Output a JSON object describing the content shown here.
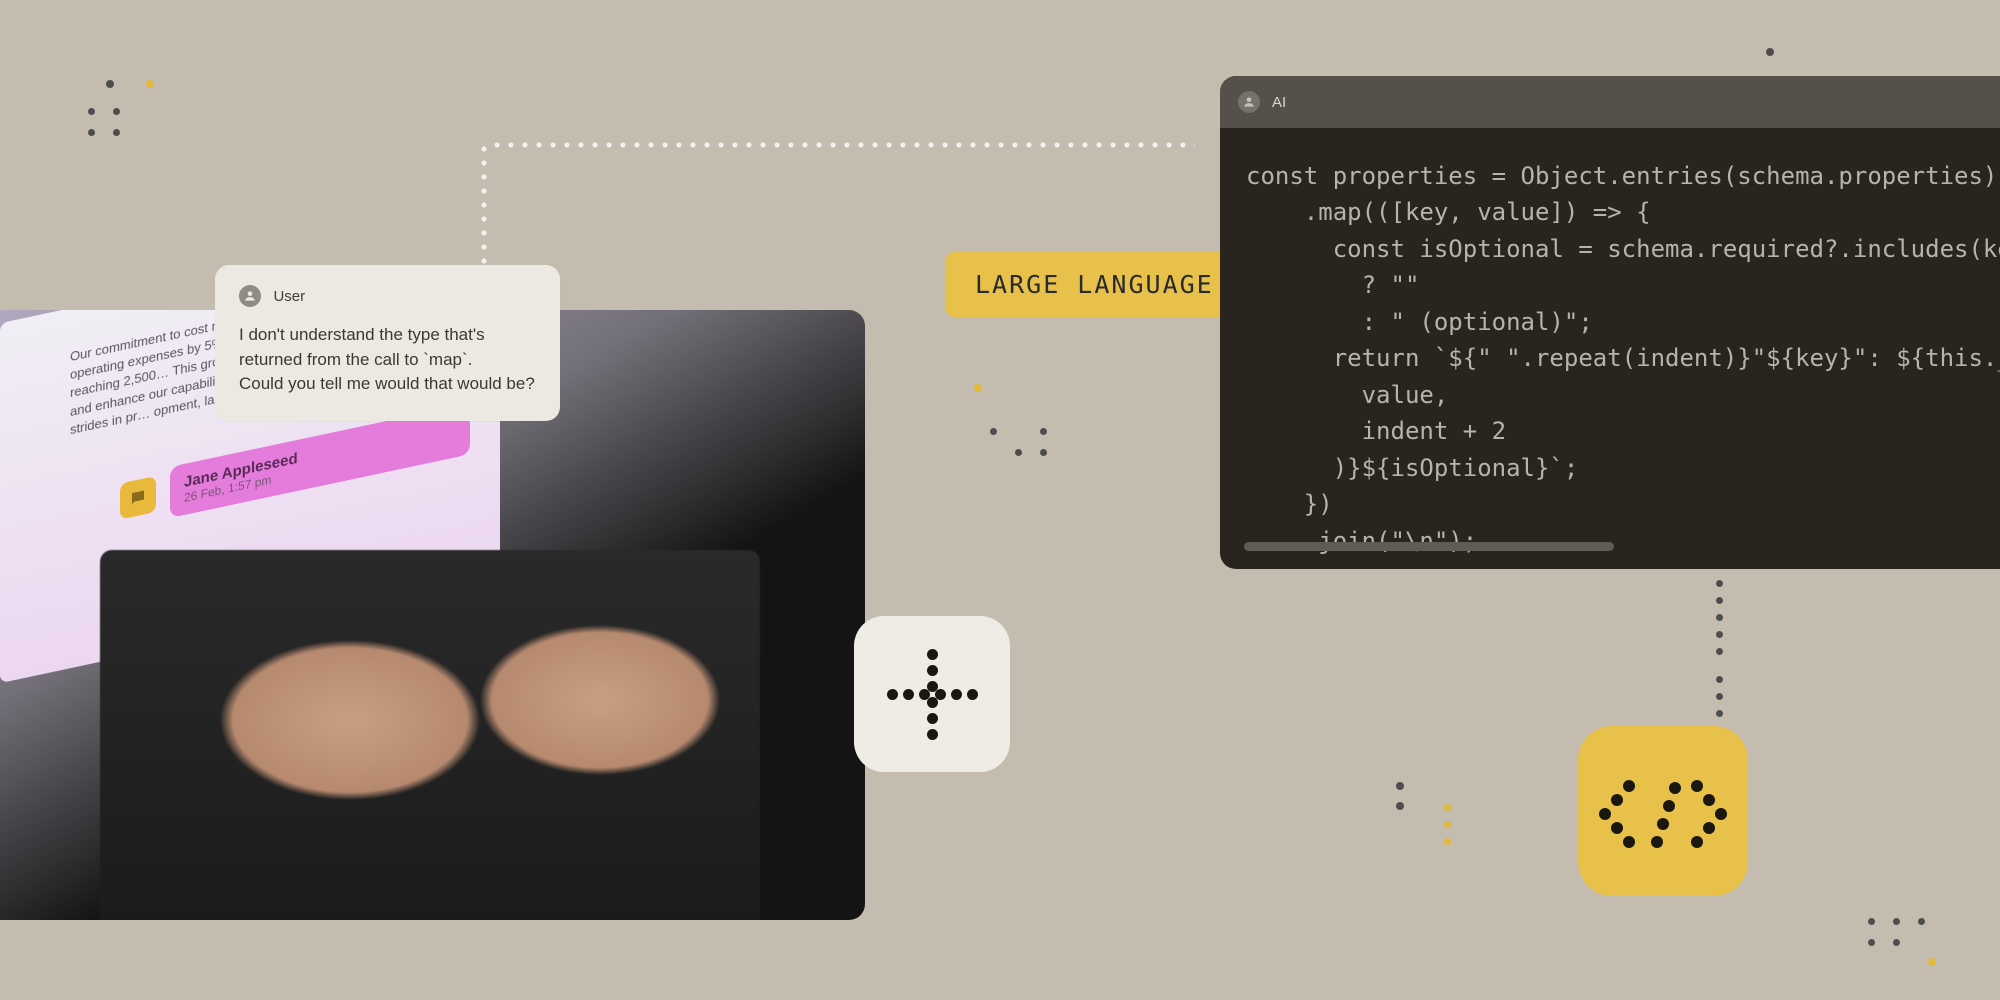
{
  "user_bubble": {
    "author": "User",
    "line1": "I don't understand the type that's",
    "line2": "returned from the call to `map`.",
    "line3": "Could you tell me would that would be?"
  },
  "screen": {
    "blurb": "Our commitment to cost management was…\nwe reduced operating expenses by 5%…\nworkforce expanded by 20%, reaching 2,500…\nThis growth allowed us to scale our…\nand enhance our capabilities.\n\nWe also made significant strides in pr…\nopment, launching five new, innovative p…",
    "person_name": "Jane Appleseed",
    "person_sub": "26 Feb, 1:57 pm"
  },
  "badge": {
    "label": "LARGE LANGUAGE MODEL"
  },
  "ai_panel": {
    "author": "AI",
    "code": "const properties = Object.entries(schema.properties)\n    .map(([key, value]) => {\n      const isOptional = schema.required?.includes(key)\n        ? \"\"\n        : \" (optional)\";\n      return `${\" \".repeat(indent)}\"${key}\": ${this._schem\n        value,\n        indent + 2\n      )}${isOptional}`;\n    })\n    .join(\"\\n\");"
  },
  "colors": {
    "bg": "#c4bcaf",
    "accent_yellow": "#e7c14a",
    "panel_dark": "#2a241f",
    "bubble": "#ece8e2"
  }
}
